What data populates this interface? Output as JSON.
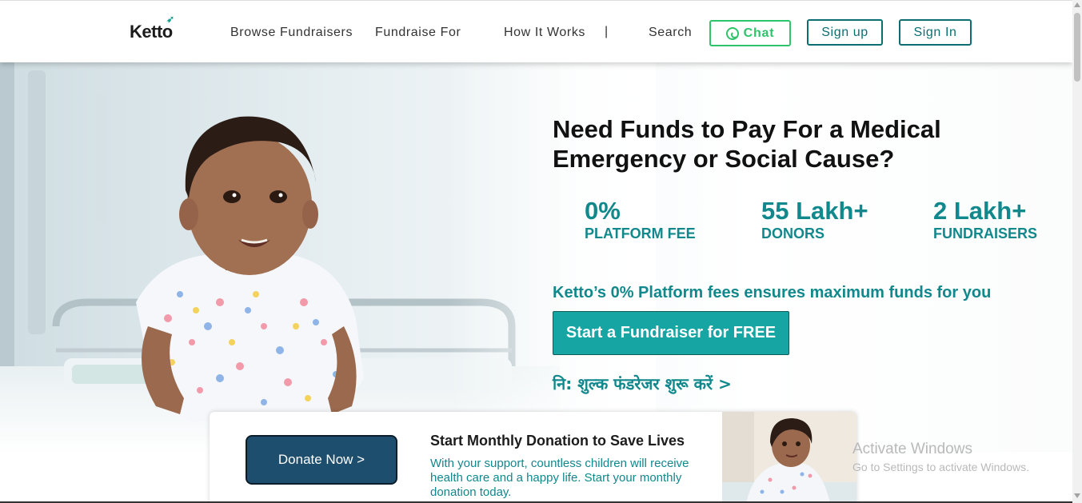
{
  "header": {
    "logo": "Ketto",
    "nav": [
      "Browse Fundraisers",
      "Fundraise For",
      "How It Works"
    ],
    "separator": "|",
    "search": "Search",
    "chat": "Chat",
    "signup": "Sign up",
    "signin": "Sign In"
  },
  "hero": {
    "headline": "Need Funds to Pay For a Medical Emergency or Social Cause?",
    "stats": [
      {
        "value": "0%",
        "label": "PLATFORM FEE"
      },
      {
        "value": "55 Lakh+",
        "label": "DONORS"
      },
      {
        "value": "2 Lakh+",
        "label": "FUNDRAISERS"
      }
    ],
    "tagline": "Ketto’s 0% Platform fees ensures maximum funds for you",
    "cta": "Start a Fundraiser for FREE",
    "hindi_link": "नि: शुल्क फंडरेजर शुरू करें >"
  },
  "monthly_card": {
    "button": "Donate Now >",
    "title": "Start Monthly Donation to Save Lives",
    "text": "With your support, countless children will receive health care and a happy life. Start your monthly donation today."
  },
  "watermark": {
    "title": "Activate Windows",
    "subtitle": "Go to Settings to activate Windows."
  },
  "colors": {
    "brand_teal": "#11888c",
    "cta_bg": "#17a5a3",
    "chat_green": "#2ec46a",
    "donate_bg": "#1e4e6e"
  }
}
